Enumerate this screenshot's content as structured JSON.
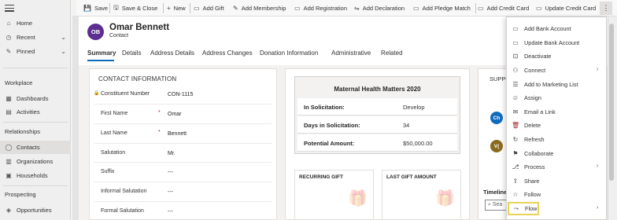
{
  "sidebar": {
    "items_top": [
      {
        "label": "Home",
        "icon": "home-icon",
        "glyph": "⌂"
      },
      {
        "label": "Recent",
        "icon": "clock-icon",
        "glyph": "◷",
        "chev": "⌄"
      },
      {
        "label": "Pinned",
        "icon": "pin-icon",
        "glyph": "✎",
        "chev": "⌄"
      }
    ],
    "sections": [
      {
        "title": "Workplace",
        "items": [
          {
            "label": "Dashboards",
            "icon": "dashboard-icon",
            "glyph": "▦"
          },
          {
            "label": "Activities",
            "icon": "activities-icon",
            "glyph": "▤"
          }
        ]
      },
      {
        "title": "Relationships",
        "items": [
          {
            "label": "Contacts",
            "icon": "person-icon",
            "glyph": "◯"
          },
          {
            "label": "Organizations",
            "icon": "organization-icon",
            "glyph": "▥"
          },
          {
            "label": "Households",
            "icon": "household-icon",
            "glyph": "▣"
          }
        ]
      },
      {
        "title": "Prospecting",
        "items": [
          {
            "label": "Opportunities",
            "icon": "opportunity-icon",
            "glyph": "◈"
          }
        ]
      }
    ]
  },
  "commands": [
    {
      "label": "Save",
      "glyph": "💾"
    },
    {
      "label": "Save & Close",
      "glyph": "🖫"
    },
    {
      "label": "New",
      "glyph": "+"
    },
    {
      "label": "Add Gift",
      "glyph": "▭"
    },
    {
      "label": "Add Membership",
      "glyph": "✎"
    },
    {
      "label": "Add Registration",
      "glyph": "▭"
    },
    {
      "label": "Add Declaration",
      "glyph": "⇋"
    },
    {
      "label": "Add Pledge Match",
      "glyph": "▭"
    },
    {
      "label": "Add Credit Card",
      "glyph": "▭"
    },
    {
      "label": "Update Credit Card",
      "glyph": "▭"
    }
  ],
  "more_glyph": "⋮",
  "record": {
    "initials": "OB",
    "name": "Omar Bennett",
    "type": "Contact",
    "avatar_color": "#5c2e91"
  },
  "tabs": [
    "Summary",
    "Details",
    "Address Details",
    "Address Changes",
    "Donation Information",
    "Administrative",
    "Related"
  ],
  "contact_info": {
    "title": "CONTACT INFORMATION",
    "lock_glyph": "🔒",
    "required_mark": "*",
    "fields": [
      {
        "label": "Constituent Number",
        "value": "CON-1115",
        "locked": true,
        "required": false
      },
      {
        "label": "First Name",
        "value": "Omar",
        "locked": false,
        "required": true
      },
      {
        "label": "Last Name",
        "value": "Bennett",
        "locked": false,
        "required": true
      },
      {
        "label": "Salutation",
        "value": "Mr.",
        "locked": false,
        "required": false
      },
      {
        "label": "Suffix",
        "value": "---",
        "locked": false,
        "required": false
      },
      {
        "label": "Informal Salutation",
        "value": "---",
        "locked": false,
        "required": false
      },
      {
        "label": "Formal Salutation",
        "value": "---",
        "locked": false,
        "required": false
      }
    ]
  },
  "campaign": {
    "title": "Maternal Health Matters 2020",
    "rows": [
      {
        "label": "In Solicitation:",
        "value": "Develop"
      },
      {
        "label": "Days in Solicitation:",
        "value": "34"
      },
      {
        "label": "Potential Amount:",
        "value": "$50,000.00"
      }
    ]
  },
  "gift_cards": [
    "RECURRING GIFT",
    "LAST GIFT AMOUNT"
  ],
  "gift_glyph": "🎁",
  "right_panel": {
    "header": "SUPPO",
    "circles": [
      {
        "initials": "Ch",
        "color": "#0f6cbd"
      },
      {
        "initials": "V(",
        "color": "#8a6a1f"
      }
    ],
    "timeline_label": "Timeline",
    "search_placeholder": "Sea"
  },
  "menu": [
    {
      "label": "Add Bank Account",
      "icon": "bank-icon",
      "glyph": "▭",
      "chev": false
    },
    {
      "label": "Update Bank Account",
      "icon": "bank-update-icon",
      "glyph": "▭",
      "chev": false
    },
    {
      "label": "Deactivate",
      "icon": "deactivate-icon",
      "glyph": "⊡",
      "chev": false
    },
    {
      "label": "Connect",
      "icon": "connect-icon",
      "glyph": "⚇",
      "chev": true
    },
    {
      "label": "Add to Marketing List",
      "icon": "marketing-list-icon",
      "glyph": "☰",
      "chev": false
    },
    {
      "label": "Assign",
      "icon": "assign-icon",
      "glyph": "☺",
      "chev": false
    },
    {
      "label": "Email a Link",
      "icon": "email-icon",
      "glyph": "✉",
      "chev": false
    },
    {
      "label": "Delete",
      "icon": "delete-icon",
      "glyph": "🗑",
      "chev": false
    },
    {
      "label": "Refresh",
      "icon": "refresh-icon",
      "glyph": "↻",
      "chev": false
    },
    {
      "label": "Collaborate",
      "icon": "collaborate-icon",
      "glyph": "⚑",
      "chev": false
    },
    {
      "label": "Process",
      "icon": "process-icon",
      "glyph": "⎇",
      "chev": true
    },
    {
      "label": "Share",
      "icon": "share-icon",
      "glyph": "⇪",
      "chev": false
    },
    {
      "label": "Follow",
      "icon": "follow-icon",
      "glyph": "☆",
      "chev": false
    },
    {
      "label": "Flow",
      "icon": "flow-icon",
      "glyph": "⤳",
      "chev": true
    }
  ]
}
